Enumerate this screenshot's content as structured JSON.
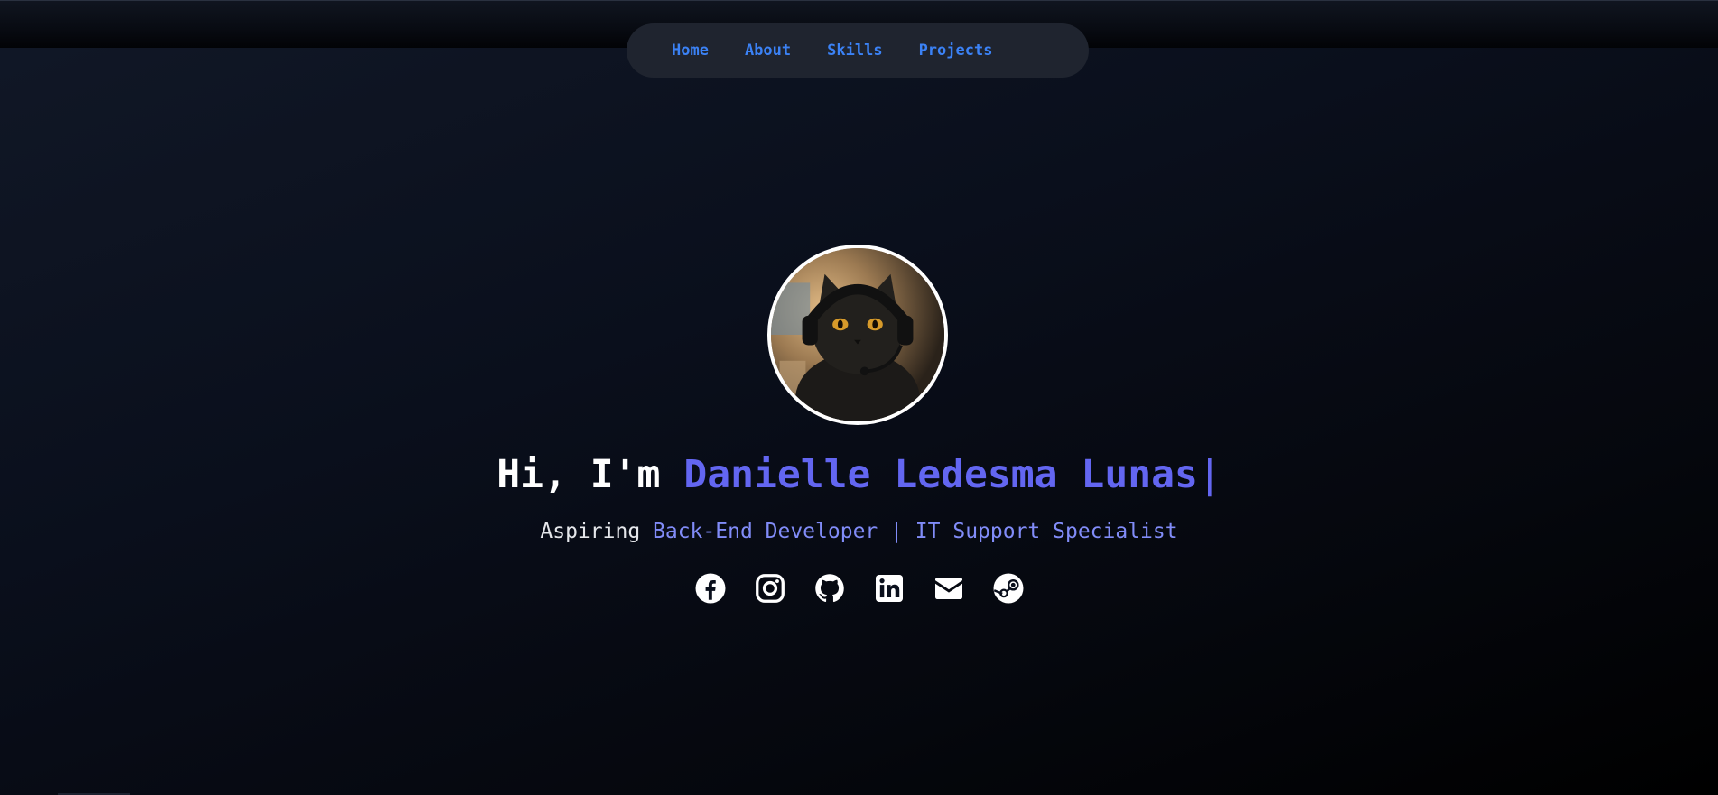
{
  "nav": {
    "items": [
      {
        "label": "Home"
      },
      {
        "label": "About"
      },
      {
        "label": "Skills"
      },
      {
        "label": "Projects"
      }
    ]
  },
  "hero": {
    "greeting": "Hi, I'm ",
    "name": "Danielle Ledesma Lunas",
    "cursor": "|",
    "subtitle_prefix": "Aspiring ",
    "subtitle_roles": "Back-End Developer | IT Support Specialist",
    "avatar_icon": "cat-with-headset-avatar"
  },
  "socials": [
    {
      "icon": "facebook-icon"
    },
    {
      "icon": "instagram-icon"
    },
    {
      "icon": "github-icon"
    },
    {
      "icon": "linkedin-icon"
    },
    {
      "icon": "email-icon"
    },
    {
      "icon": "steam-icon"
    }
  ],
  "colors": {
    "accent": "#6366f1",
    "nav_link": "#3b82f6",
    "subtitle_accent": "#818cf8",
    "background": "#0a0f1c"
  }
}
